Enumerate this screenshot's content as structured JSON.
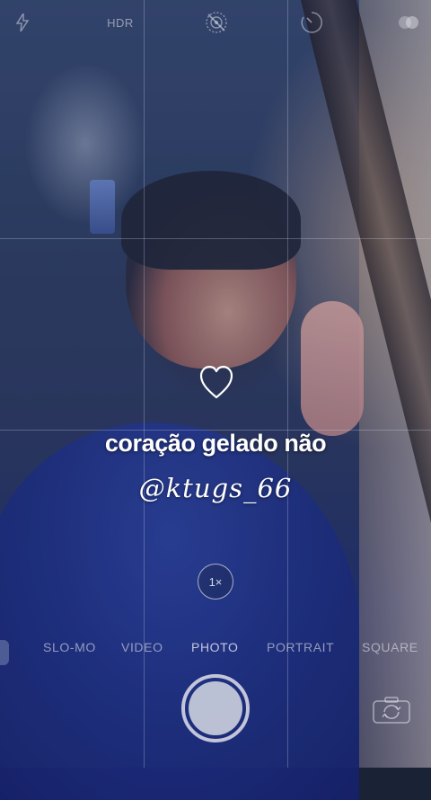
{
  "top_bar": {
    "hdr_label": "HDR",
    "icons": [
      "flash-icon",
      "live-photo-off-icon",
      "timer-icon",
      "filters-icon"
    ]
  },
  "overlay": {
    "heart_icon": "heart-outline-icon",
    "caption": "coração gelado não",
    "handle": "@ktugs_66"
  },
  "camera": {
    "zoom_label": "1×",
    "modes": [
      "SLO-MO",
      "VIDEO",
      "PHOTO",
      "PORTRAIT",
      "SQUARE"
    ],
    "active_mode": "PHOTO"
  },
  "colors": {
    "text": "#ffffff",
    "tint": "#2a3a6a",
    "shirt": "#1c2b80"
  }
}
